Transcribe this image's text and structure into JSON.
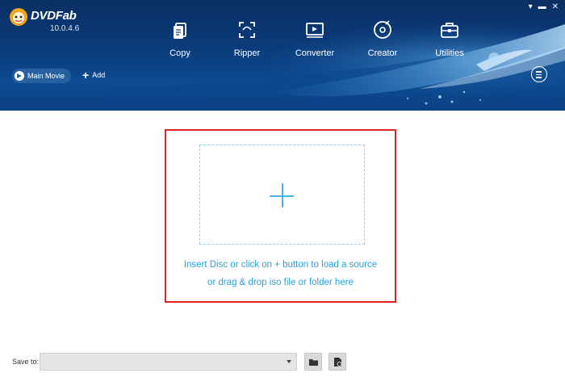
{
  "app": {
    "name": "DVDFab",
    "version": "10.0.4.6"
  },
  "window_controls": [
    "▾",
    "▬",
    "✕"
  ],
  "modules": [
    {
      "label": "Copy",
      "icon": "copy-icon"
    },
    {
      "label": "Ripper",
      "icon": "ripper-icon"
    },
    {
      "label": "Converter",
      "icon": "converter-icon"
    },
    {
      "label": "Creator",
      "icon": "creator-icon"
    },
    {
      "label": "Utilities",
      "icon": "utilities-icon"
    }
  ],
  "toolbar": {
    "mode_label": "Main Movie",
    "add_label": "Add"
  },
  "drop_zone": {
    "line1": "Insert Disc or click on + button to load a source",
    "line2": "or drag & drop iso file or folder here"
  },
  "footer": {
    "save_to_label": "Save to:",
    "save_to_value": ""
  },
  "colors": {
    "header_bg": "#0a3a78",
    "accent": "#2a9ed8",
    "highlight_outline": "#e02424"
  }
}
